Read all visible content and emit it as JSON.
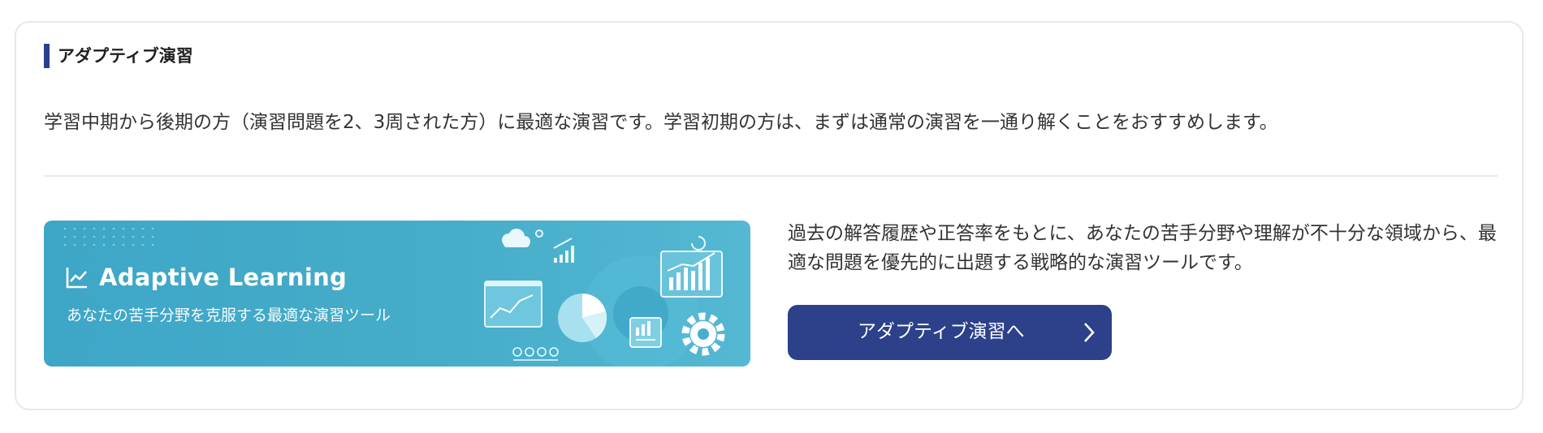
{
  "section": {
    "title": "アダプティブ演習",
    "intro": "学習中期から後期の方（演習問題を2、3周された方）に最適な演習です。学習初期の方は、まずは通常の演習を一通り解くことをおすすめします。"
  },
  "banner": {
    "title": "Adaptive Learning",
    "subtitle": "あなたの苦手分野を克服する最適な演習ツール",
    "icon": "trend-chart-icon"
  },
  "description": "過去の解答履歴や正答率をもとに、あなたの苦手分野や理解が不十分な領域から、最適な問題を優先的に出題する戦略的な演習ツールです。",
  "cta": {
    "label": "アダプティブ演習へ",
    "icon": "chevron-right-icon"
  },
  "colors": {
    "accent": "#2c4189",
    "banner": "#45acc9",
    "border": "#e5e8ec"
  }
}
